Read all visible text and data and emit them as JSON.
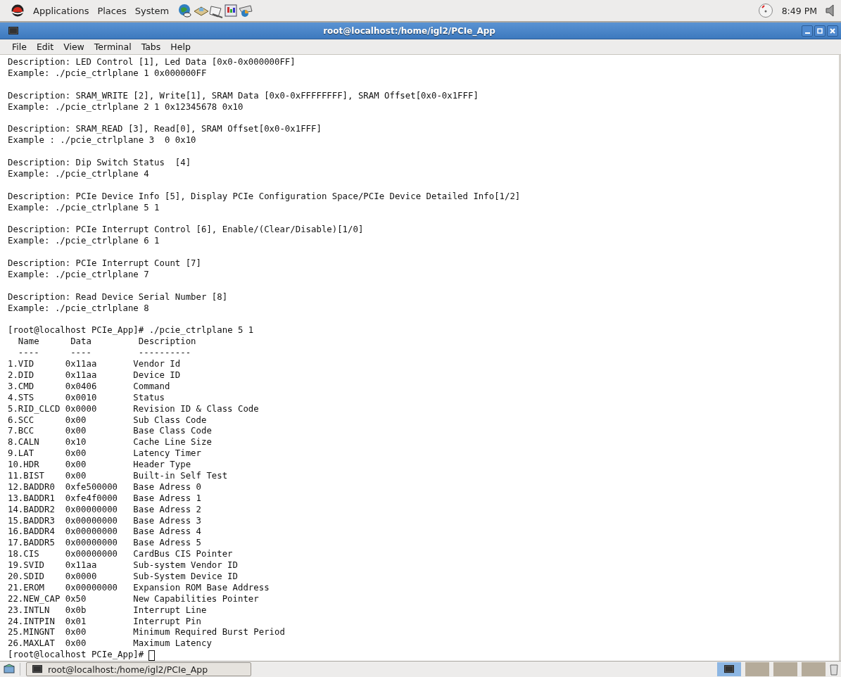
{
  "top_panel": {
    "menus": [
      "Applications",
      "Places",
      "System"
    ],
    "clock": "8:49 PM"
  },
  "window": {
    "title": "root@localhost:/home/igl2/PCIe_App"
  },
  "menu_bar": [
    "File",
    "Edit",
    "View",
    "Terminal",
    "Tabs",
    "Help"
  ],
  "terminal": {
    "sections": [
      {
        "description": "Description: LED Control [1], Led Data [0x0-0x000000FF]",
        "example": "Example: ./pcie_ctrlplane 1 0x000000FF"
      },
      {
        "description": "Description: SRAM_WRITE [2], Write[1], SRAM Data [0x0-0xFFFFFFFF], SRAM Offset[0x0-0x1FFF]",
        "example": "Example: ./pcie_ctrlplane 2 1 0x12345678 0x10"
      },
      {
        "description": "Description: SRAM_READ [3], Read[0], SRAM Offset[0x0-0x1FFF]",
        "example": "Example : ./pcie_ctrlplane 3  0 0x10"
      },
      {
        "description": "Description: Dip Switch Status  [4]",
        "example": "Example: ./pcie_ctrlplane 4"
      },
      {
        "description": "Description: PCIe Device Info [5], Display PCIe Configuration Space/PCIe Device Detailed Info[1/2]",
        "example": "Example: ./pcie_ctrlplane 5 1"
      },
      {
        "description": "Description: PCIe Interrupt Control [6], Enable/(Clear/Disable)[1/0]",
        "example": "Example: ./pcie_ctrlplane 6 1"
      },
      {
        "description": "Description: PCIe Interrupt Count [7]",
        "example": "Example: ./pcie_ctrlplane 7"
      },
      {
        "description": "Description: Read Device Serial Number [8]",
        "example": "Example: ./pcie_ctrlplane 8"
      }
    ],
    "command": "[root@localhost PCIe_App]# ./pcie_ctrlplane 5 1",
    "header": "  Name      Data         Description",
    "rule": "  ----      ----         ----------",
    "rows": [
      {
        "name": "1.VID",
        "data": "0x11aa",
        "description": "Vendor Id"
      },
      {
        "name": "2.DID",
        "data": "0x11aa",
        "description": "Device ID"
      },
      {
        "name": "3.CMD",
        "data": "0x0406",
        "description": "Command"
      },
      {
        "name": "4.STS",
        "data": "0x0010",
        "description": "Status"
      },
      {
        "name": "5.RID_CLCD",
        "data": "0x0000",
        "description": "Revision ID & Class Code"
      },
      {
        "name": "6.SCC",
        "data": "0x00",
        "description": "Sub Class Code"
      },
      {
        "name": "7.BCC",
        "data": "0x00",
        "description": "Base Class Code"
      },
      {
        "name": "8.CALN",
        "data": "0x10",
        "description": "Cache Line Size"
      },
      {
        "name": "9.LAT",
        "data": "0x00",
        "description": "Latency Timer"
      },
      {
        "name": "10.HDR",
        "data": "0x00",
        "description": "Header Type"
      },
      {
        "name": "11.BIST",
        "data": "0x00",
        "description": "Built-in Self Test"
      },
      {
        "name": "12.BADDR0",
        "data": "0xfe500000",
        "description": "Base Adress 0"
      },
      {
        "name": "13.BADDR1",
        "data": "0xfe4f0000",
        "description": "Base Adress 1"
      },
      {
        "name": "14.BADDR2",
        "data": "0x00000000",
        "description": "Base Adress 2"
      },
      {
        "name": "15.BADDR3",
        "data": "0x00000000",
        "description": "Base Adress 3"
      },
      {
        "name": "16.BADDR4",
        "data": "0x00000000",
        "description": "Base Adress 4"
      },
      {
        "name": "17.BADDR5",
        "data": "0x00000000",
        "description": "Base Adress 5"
      },
      {
        "name": "18.CIS",
        "data": "0x00000000",
        "description": "CardBus CIS Pointer"
      },
      {
        "name": "19.SVID",
        "data": "0x11aa",
        "description": "Sub-system Vendor ID"
      },
      {
        "name": "20.SDID",
        "data": "0x0000",
        "description": "Sub-System Device ID"
      },
      {
        "name": "21.EROM",
        "data": "0x00000000",
        "description": "Expansion ROM Base Address"
      },
      {
        "name": "22.NEW_CAP",
        "data": "0x50",
        "description": "New Capabilities Pointer"
      },
      {
        "name": "23.INTLN",
        "data": "0x0b",
        "description": "Interrupt Line"
      },
      {
        "name": "24.INTPIN",
        "data": "0x01",
        "description": "Interrupt Pin"
      },
      {
        "name": "25.MINGNT",
        "data": "0x00",
        "description": "Minimum Required Burst Period"
      },
      {
        "name": "26.MAXLAT",
        "data": "0x00",
        "description": "Maximum Latency"
      }
    ],
    "prompt": "[root@localhost PCIe_App]#"
  },
  "taskbar": {
    "windows": [
      {
        "label": "root@localhost:/home/igl2/PCIe_App",
        "selected": false
      }
    ]
  }
}
